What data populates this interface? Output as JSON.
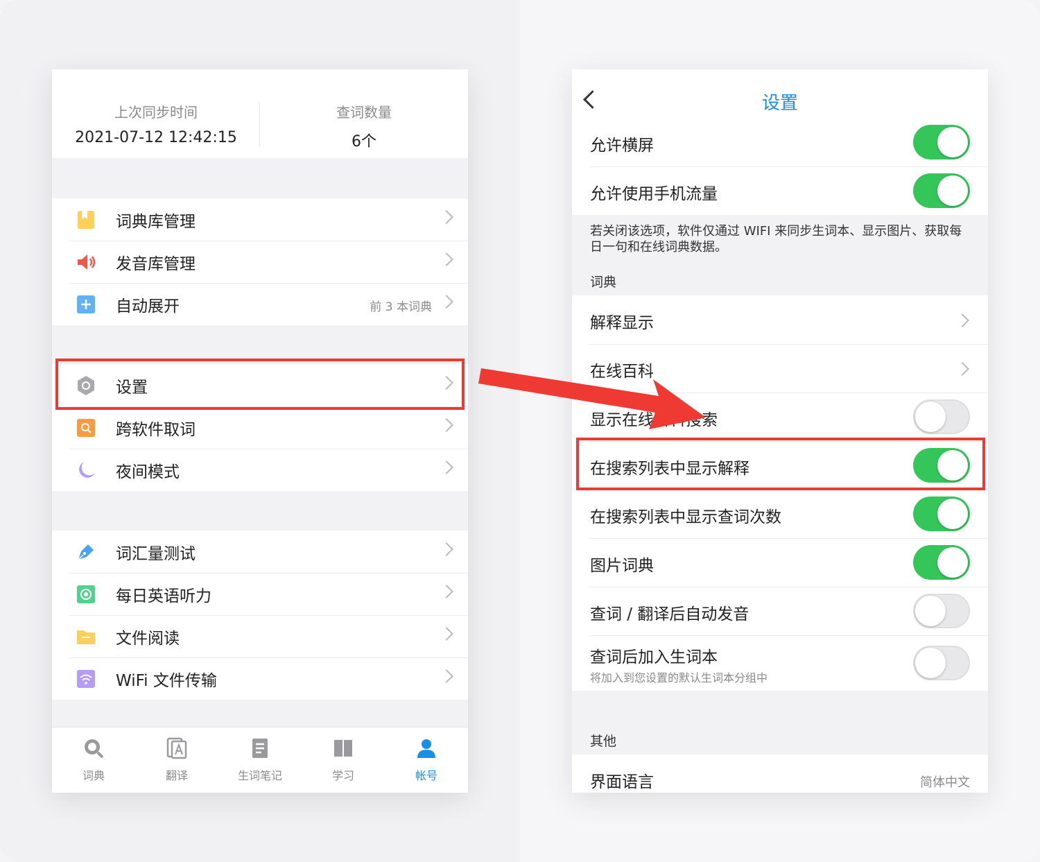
{
  "left": {
    "sync": {
      "last_sync_label": "上次同步时间",
      "last_sync_value": "2021-07-12 12:42:15",
      "lookup_count_label": "查词数量",
      "lookup_count_value": "6个"
    },
    "group1": [
      {
        "label": "词典库管理",
        "icon": "bookmark-icon"
      },
      {
        "label": "发音库管理",
        "icon": "speaker-icon"
      },
      {
        "label": "自动展开",
        "icon": "plus-icon",
        "sub": "前 3 本词典"
      }
    ],
    "group2": [
      {
        "label": "设置",
        "icon": "gear-icon"
      },
      {
        "label": "跨软件取词",
        "icon": "search-icon"
      },
      {
        "label": "夜间模式",
        "icon": "moon-icon"
      }
    ],
    "group3": [
      {
        "label": "词汇量测试",
        "icon": "pen-icon"
      },
      {
        "label": "每日英语听力",
        "icon": "play-icon"
      },
      {
        "label": "文件阅读",
        "icon": "folder-icon"
      },
      {
        "label": "WiFi 文件传输",
        "icon": "wifi-icon"
      }
    ],
    "tabbar": [
      {
        "label": "词典",
        "icon": "magnifier-icon"
      },
      {
        "label": "翻译",
        "icon": "translate-icon"
      },
      {
        "label": "生词笔记",
        "icon": "note-icon"
      },
      {
        "label": "学习",
        "icon": "book-icon"
      },
      {
        "label": "帐号",
        "icon": "user-icon",
        "active": true
      }
    ]
  },
  "right": {
    "title": "设置",
    "top_toggles": [
      {
        "label": "允许横屏",
        "on": true
      },
      {
        "label": "允许使用手机流量",
        "on": true
      }
    ],
    "note": "若关闭该选项，软件仅通过 WIFI 来同步生词本、显示图片、获取每日一句和在线词典数据。",
    "section_dict": "词典",
    "dict_rows": [
      {
        "label": "解释显示",
        "type": "link"
      },
      {
        "label": "在线百科",
        "type": "link"
      },
      {
        "label": "显示在线百科搜索",
        "type": "toggle",
        "on": false
      },
      {
        "label": "在搜索列表中显示解释",
        "type": "toggle",
        "on": true
      },
      {
        "label": "在搜索列表中显示查词次数",
        "type": "toggle",
        "on": true
      },
      {
        "label": "图片词典",
        "type": "toggle",
        "on": true
      },
      {
        "label": "查词 / 翻译后自动发音",
        "type": "toggle",
        "on": false
      },
      {
        "label": "查词后加入生词本",
        "hint": "将加入到您设置的默认生词本分组中",
        "type": "toggle",
        "on": false
      }
    ],
    "section_other": "其他",
    "other_rows": [
      {
        "label": "界面语言",
        "value": "简体中文"
      }
    ]
  },
  "colors": {
    "accent": "#1a8fe8",
    "toggle_on": "#34c659",
    "highlight": "#ee3a32"
  }
}
